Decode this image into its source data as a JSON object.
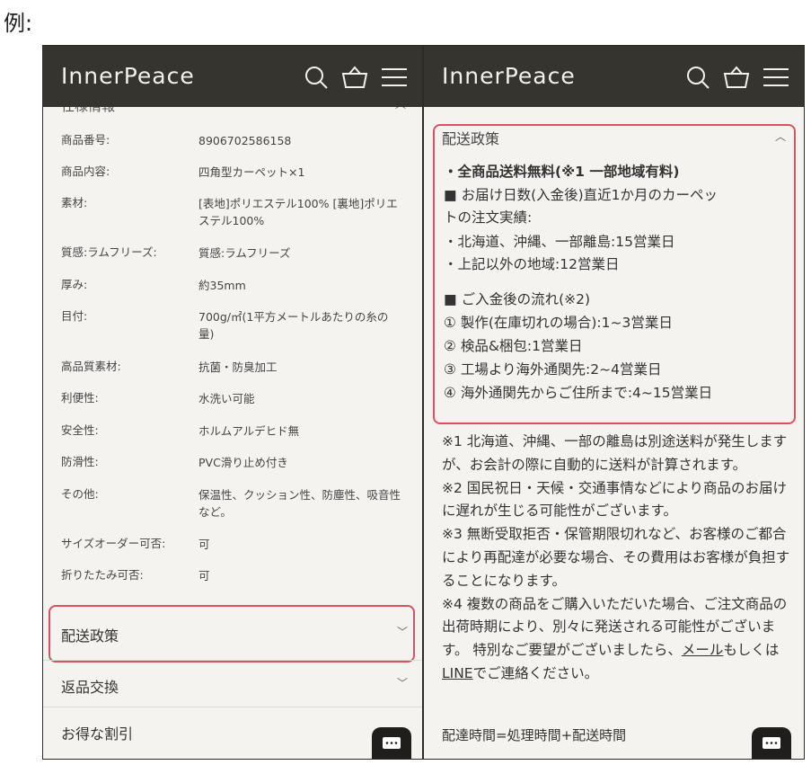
{
  "page_label": "例:",
  "brand": "InnerPeace",
  "left": {
    "spec_title": "仕様情報",
    "specs": [
      {
        "k": "商品番号:",
        "v": "8906702586158"
      },
      {
        "k": "商品内容:",
        "v": "四角型カーペット×1"
      },
      {
        "k": "素材:",
        "v": "[表地]ポリエステル100% [裏地]ポリエステル100%"
      },
      {
        "k": "質感:ラムフリーズ:",
        "v": "質感:ラムフリーズ"
      },
      {
        "k": "厚み:",
        "v": "約35mm"
      },
      {
        "k": "目付:",
        "v": "700g/㎡(1平方メートルあたりの糸の量)"
      },
      {
        "k": "高品質素材:",
        "v": "抗菌・防臭加工"
      },
      {
        "k": "利便性:",
        "v": "水洗い可能"
      },
      {
        "k": "安全性:",
        "v": "ホルムアルデヒド無"
      },
      {
        "k": "防滑性:",
        "v": "PVC滑り止め付き"
      },
      {
        "k": "その他:",
        "v": "保温性、クッション性、防塵性、吸音性など。"
      },
      {
        "k": "サイズオーダー可否:",
        "v": "可"
      },
      {
        "k": "折りたたみ可否:",
        "v": "可"
      }
    ],
    "accordion": [
      "配送政策",
      "返品交換",
      "お得な割引"
    ]
  },
  "right": {
    "policy_title": "配送政策",
    "policy_lines": [
      "・全商品送料無料(※1 一部地域有料)",
      "■ お届け日数(入金後)直近1か月のカーペッ",
      "トの注文実績:",
      "・北海道、沖縄、一部離島:15営業日",
      "・上記以外の地域:12営業日",
      "■ ご入金後の流れ(※2)",
      "① 製作(在庫切れの場合):1~3営業日",
      "② 検品&梱包:1営業日",
      "③ 工場より海外通関先:2~4営業日",
      "④ 海外通関先からご住所まで:4~15営業日"
    ],
    "notes": [
      "※1 北海道、沖縄、一部の離島は別途送料が発生しますが、お会計の際に自動的に送料が計算されます。",
      "※2 国民祝日・天候・交通事情などにより商品のお届けに遅れが生じる可能性がございます。",
      "※3 無断受取拒否・保管期限切れなど、お客様のご都合により再配達が必要な場合、その費用はお客様が負担することになります。"
    ],
    "note4": {
      "pre": "※4 複数の商品をご購入いただいた場合、ご注文商品の出荷時期により、別々に発送される可能性がございます。 特別なご要望がございましたら、",
      "mail": "メール",
      "mid": "もしくは",
      "line": "LINE",
      "post": "でご連絡ください。"
    },
    "delivery_time": "配達時間=処理時間+配送時間"
  },
  "colors": {
    "header": "#36342f",
    "background": "#f5f3f0",
    "highlight": "#d9535d"
  }
}
